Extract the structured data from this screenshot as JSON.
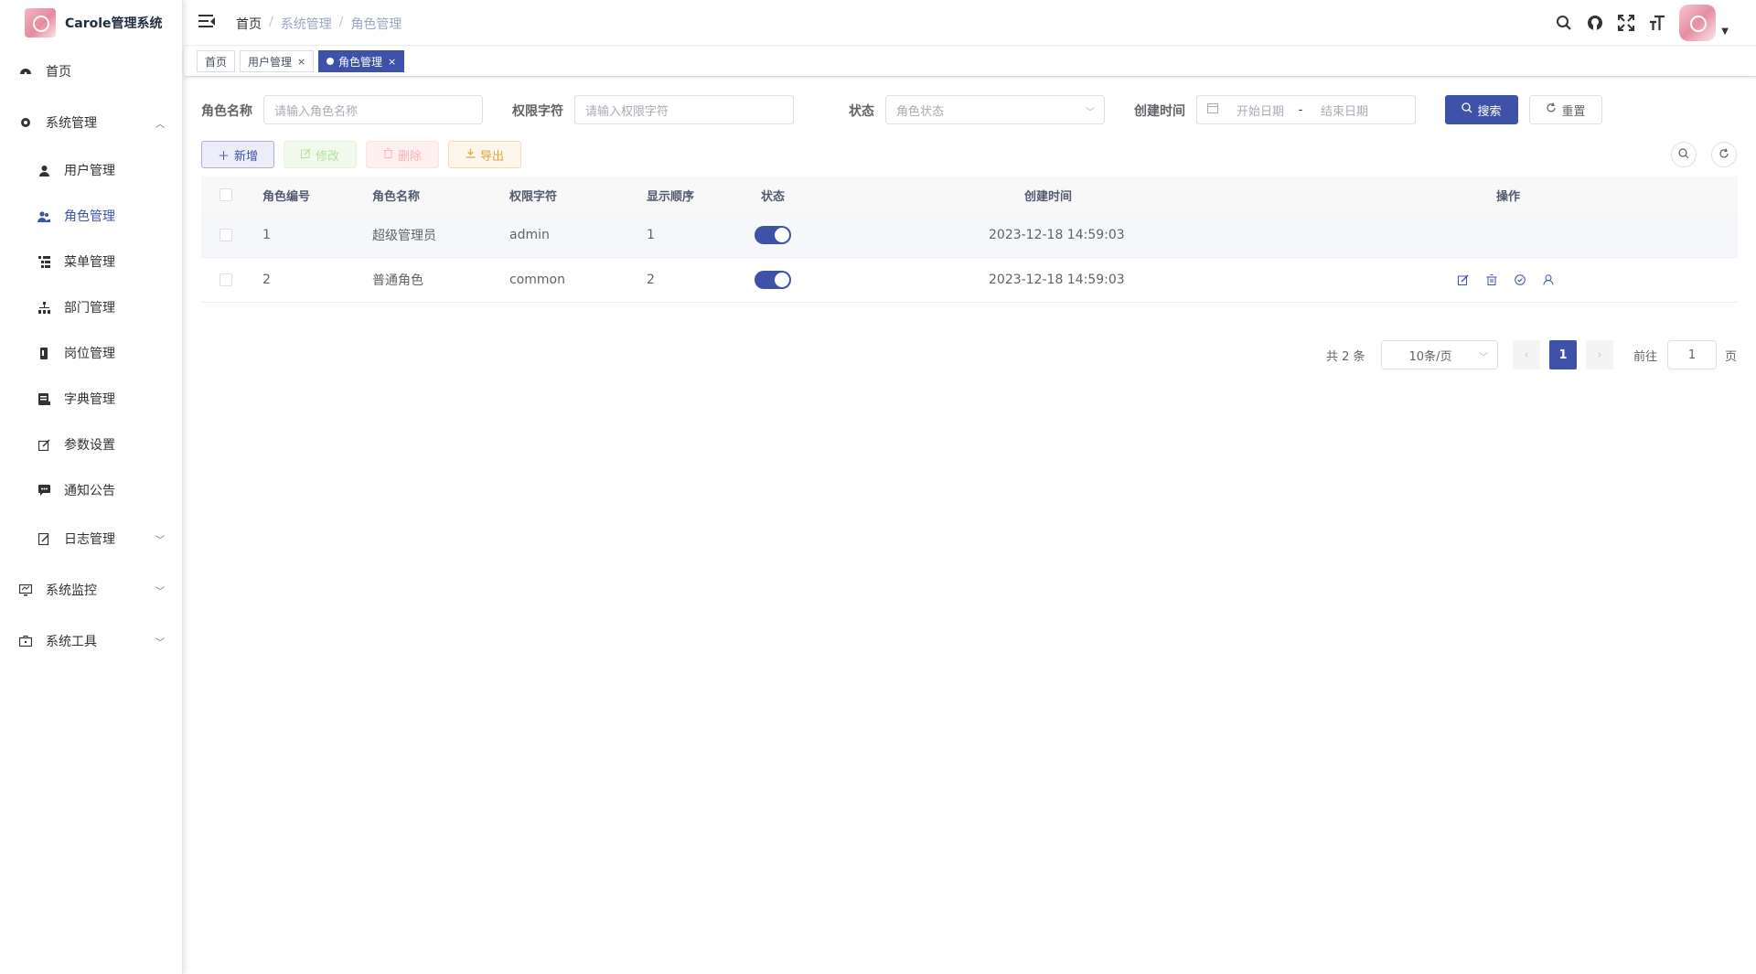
{
  "app": {
    "title": "Carole管理系统"
  },
  "sidebar": {
    "home": "首页",
    "system": "系统管理",
    "items": [
      {
        "label": "用户管理",
        "icon": "user-icon"
      },
      {
        "label": "角色管理",
        "icon": "peoples-icon"
      },
      {
        "label": "菜单管理",
        "icon": "tree-table-icon"
      },
      {
        "label": "部门管理",
        "icon": "tree-icon"
      },
      {
        "label": "岗位管理",
        "icon": "post-icon"
      },
      {
        "label": "字典管理",
        "icon": "dict-icon"
      },
      {
        "label": "参数设置",
        "icon": "edit-icon"
      },
      {
        "label": "通知公告",
        "icon": "message-icon"
      },
      {
        "label": "日志管理",
        "icon": "log-icon"
      }
    ],
    "monitor": "系统监控",
    "tools": "系统工具"
  },
  "navbar": {
    "breadcrumb": [
      "首页",
      "系统管理",
      "角色管理"
    ],
    "separator": "/"
  },
  "tags": {
    "home": "首页",
    "user": "用户管理",
    "role": "角色管理",
    "close": "×"
  },
  "search": {
    "role_name_label": "角色名称",
    "role_name_placeholder": "请输入角色名称",
    "perm_label": "权限字符",
    "perm_placeholder": "请输入权限字符",
    "status_label": "状态",
    "status_placeholder": "角色状态",
    "date_label": "创建时间",
    "start_placeholder": "开始日期",
    "date_sep": "-",
    "end_placeholder": "结束日期",
    "search_btn": "搜索",
    "reset_btn": "重置"
  },
  "toolbar": {
    "add": "新增",
    "edit": "修改",
    "delete": "删除",
    "export": "导出"
  },
  "table": {
    "headers": [
      "角色编号",
      "角色名称",
      "权限字符",
      "显示顺序",
      "状态",
      "创建时间",
      "操作"
    ],
    "rows": [
      {
        "id": "1",
        "name": "超级管理员",
        "key": "admin",
        "sort": "1",
        "status_on": true,
        "created": "2023-12-18 14:59:03"
      },
      {
        "id": "2",
        "name": "普通角色",
        "key": "common",
        "sort": "2",
        "status_on": true,
        "created": "2023-12-18 14:59:03"
      }
    ]
  },
  "pagination": {
    "total": "共 2 条",
    "page_size": "10条/页",
    "current": "1",
    "goto_prefix": "前往",
    "goto_value": "1",
    "goto_suffix": "页"
  },
  "colors": {
    "primary": "#3d52a8"
  }
}
